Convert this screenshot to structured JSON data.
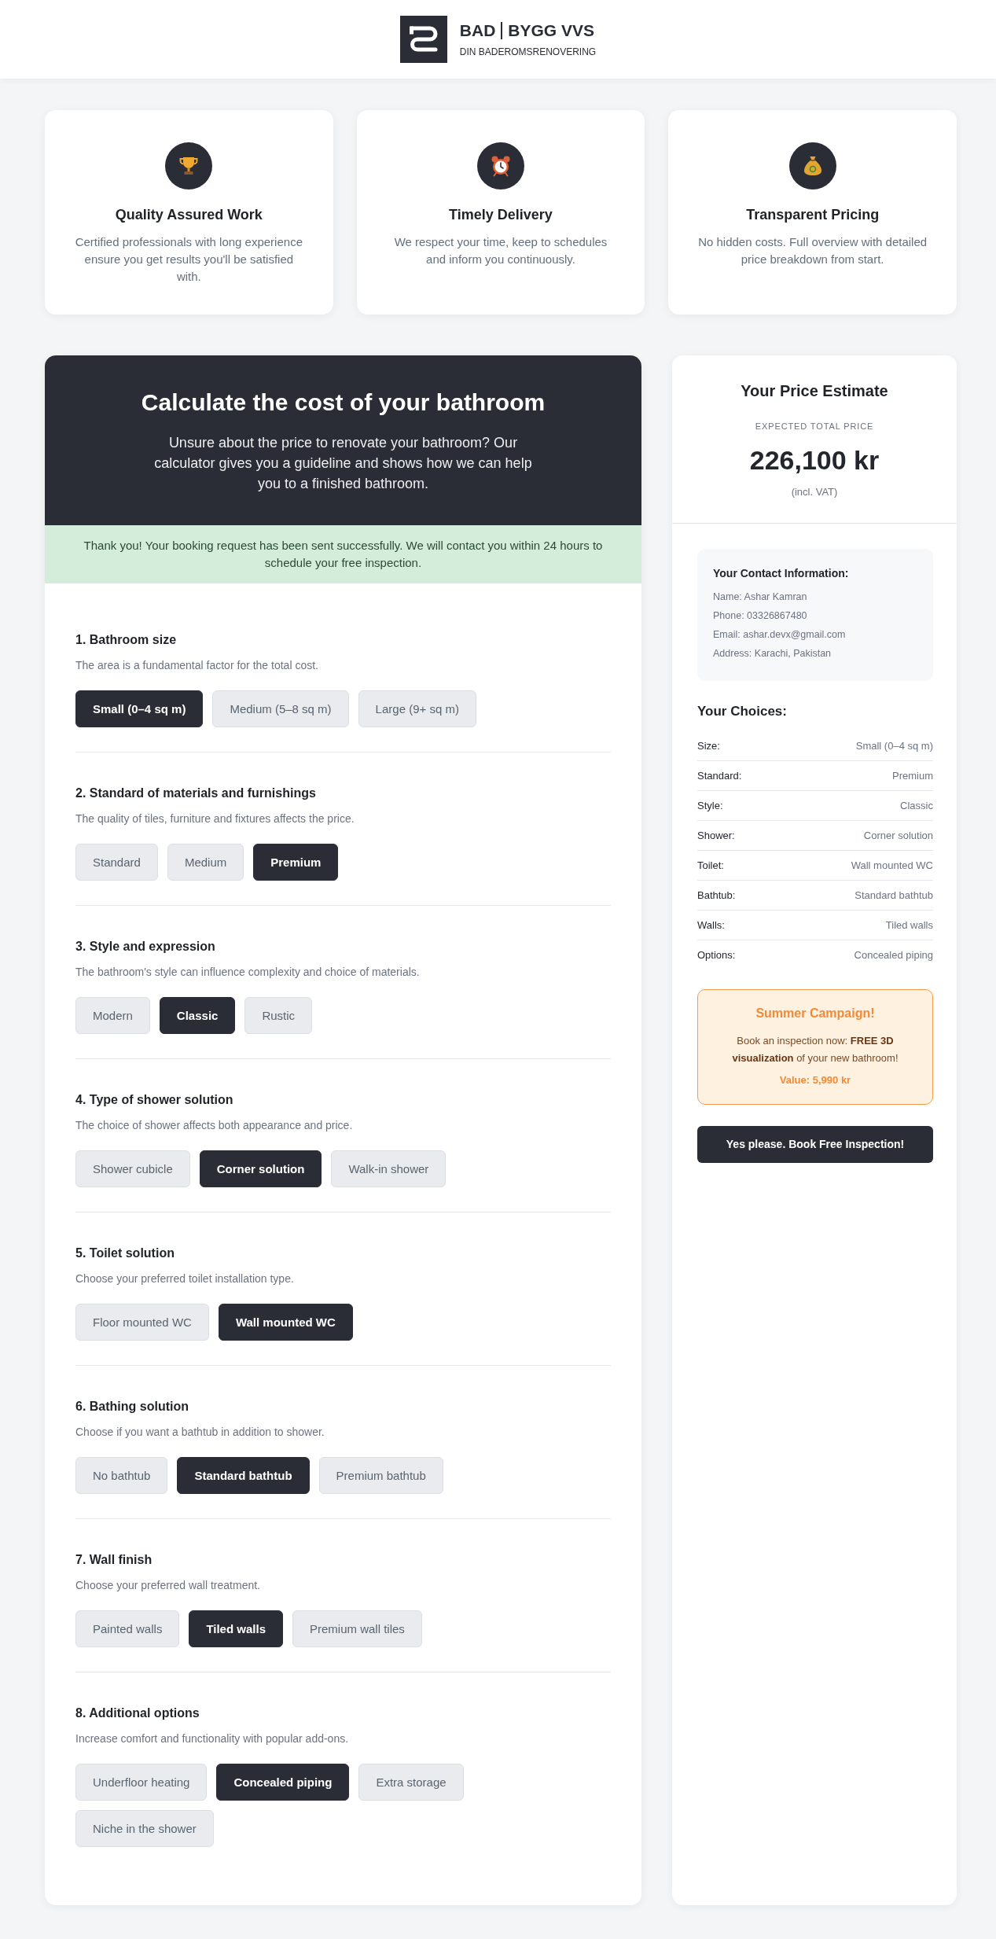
{
  "header": {
    "brand_words": [
      "BAD",
      "BYGG VVS"
    ],
    "tagline": "DIN BADEROMSRENOVERING"
  },
  "features": [
    {
      "title": "Quality Assured Work",
      "description": "Certified professionals with long experience ensure you get results you'll be satisfied with."
    },
    {
      "title": "Timely Delivery",
      "description": "We respect your time, keep to schedules and inform you continuously."
    },
    {
      "title": "Transparent Pricing",
      "description": "No hidden costs. Full overview with detailed price breakdown from start."
    }
  ],
  "calculator": {
    "title": "Calculate the cost of your bathroom",
    "intro": "Unsure about the price to renovate your bathroom? Our calculator gives you a guideline and shows how we can help you to a finished bathroom.",
    "notice": "Thank you! Your booking request has been sent successfully. We will contact you within 24 hours to schedule your free inspection.",
    "sections": [
      {
        "title": "1. Bathroom size",
        "description": "The area is a fundamental factor for the total cost.",
        "options": [
          {
            "label": "Small (0–4 sq m)",
            "selected": true
          },
          {
            "label": "Medium (5–8 sq m)",
            "selected": false
          },
          {
            "label": "Large (9+ sq m)",
            "selected": false
          }
        ]
      },
      {
        "title": "2. Standard of materials and furnishings",
        "description": "The quality of tiles, furniture and fixtures affects the price.",
        "options": [
          {
            "label": "Standard",
            "selected": false
          },
          {
            "label": "Medium",
            "selected": false
          },
          {
            "label": "Premium",
            "selected": true
          }
        ]
      },
      {
        "title": "3. Style and expression",
        "description": "The bathroom's style can influence complexity and choice of materials.",
        "options": [
          {
            "label": "Modern",
            "selected": false
          },
          {
            "label": "Classic",
            "selected": true
          },
          {
            "label": "Rustic",
            "selected": false
          }
        ]
      },
      {
        "title": "4. Type of shower solution",
        "description": "The choice of shower affects both appearance and price.",
        "options": [
          {
            "label": "Shower cubicle",
            "selected": false
          },
          {
            "label": "Corner solution",
            "selected": true
          },
          {
            "label": "Walk-in shower",
            "selected": false
          }
        ]
      },
      {
        "title": "5. Toilet solution",
        "description": "Choose your preferred toilet installation type.",
        "options": [
          {
            "label": "Floor mounted WC",
            "selected": false
          },
          {
            "label": "Wall mounted WC",
            "selected": true
          }
        ]
      },
      {
        "title": "6. Bathing solution",
        "description": "Choose if you want a bathtub in addition to shower.",
        "options": [
          {
            "label": "No bathtub",
            "selected": false
          },
          {
            "label": "Standard bathtub",
            "selected": true
          },
          {
            "label": "Premium bathtub",
            "selected": false
          }
        ]
      },
      {
        "title": "7. Wall finish",
        "description": "Choose your preferred wall treatment.",
        "options": [
          {
            "label": "Painted walls",
            "selected": false
          },
          {
            "label": "Tiled walls",
            "selected": true
          },
          {
            "label": "Premium wall tiles",
            "selected": false
          }
        ]
      },
      {
        "title": "8. Additional options",
        "description": "Increase comfort and functionality with popular add-ons.",
        "options": [
          {
            "label": "Underfloor heating",
            "selected": false
          },
          {
            "label": "Concealed piping",
            "selected": true
          },
          {
            "label": "Extra storage",
            "selected": false
          },
          {
            "label": "Niche in the shower",
            "selected": false
          }
        ]
      }
    ]
  },
  "estimate": {
    "title": "Your Price Estimate",
    "price_label": "EXPECTED TOTAL PRICE",
    "price": "226,100 kr",
    "price_note": "(incl. VAT)",
    "contact": {
      "title": "Your Contact Information:",
      "lines": [
        "Name: Ashar Kamran",
        "Phone: 03326867480",
        "Email: ashar.devx@gmail.com",
        "Address: Karachi, Pakistan"
      ]
    },
    "choices_title": "Your Choices:",
    "choices": [
      {
        "label": "Size:",
        "value": "Small (0–4 sq m)"
      },
      {
        "label": "Standard:",
        "value": "Premium"
      },
      {
        "label": "Style:",
        "value": "Classic"
      },
      {
        "label": "Shower:",
        "value": "Corner solution"
      },
      {
        "label": "Toilet:",
        "value": "Wall mounted WC"
      },
      {
        "label": "Bathtub:",
        "value": "Standard bathtub"
      },
      {
        "label": "Walls:",
        "value": "Tiled walls"
      },
      {
        "label": "Options:",
        "value": "Concealed piping"
      }
    ],
    "campaign": {
      "title": "Summer Campaign!",
      "text": "Book an inspection now: **FREE 3D visualization** of your new bathroom!",
      "value": "Value: 5,990 kr"
    },
    "button": "Yes please. Book Free Inspection!"
  }
}
